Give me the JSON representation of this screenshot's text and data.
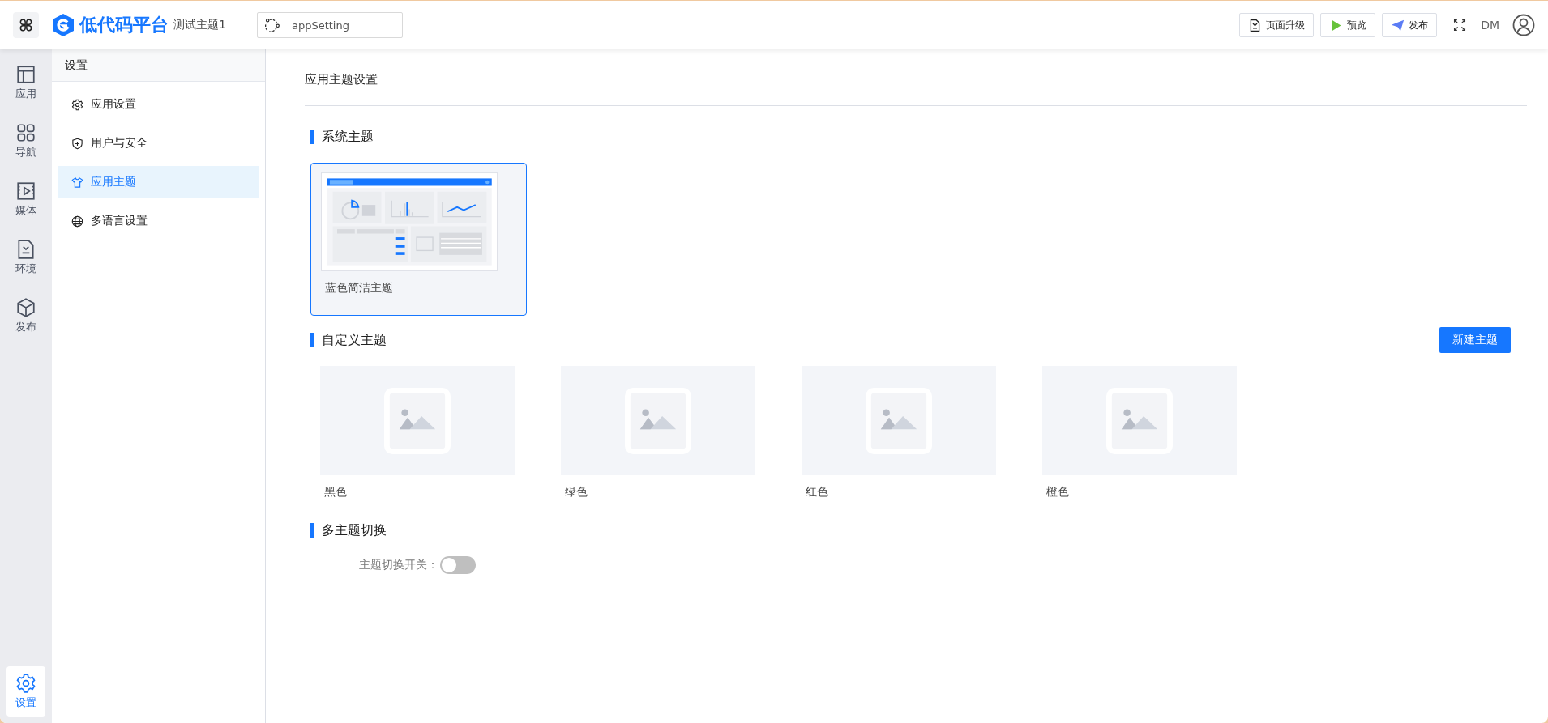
{
  "header": {
    "app_name": "低代码平台",
    "project": "测试主题1",
    "page_selector": "appSetting",
    "buttons": [
      {
        "label": "页面升级",
        "kind": "upgrade"
      },
      {
        "label": "预览",
        "kind": "preview"
      },
      {
        "label": "发布",
        "kind": "publish"
      }
    ],
    "user": "DM"
  },
  "rail": {
    "items": [
      {
        "label": "应用",
        "selected": false
      },
      {
        "label": "导航",
        "selected": false
      },
      {
        "label": "媒体",
        "selected": false
      },
      {
        "label": "环境",
        "selected": false
      },
      {
        "label": "发布",
        "selected": false
      }
    ],
    "bottom": {
      "label": "设置",
      "selected": true
    }
  },
  "sidebar": {
    "title": "设置",
    "items": [
      {
        "label": "应用设置",
        "selected": false
      },
      {
        "label": "用户与安全",
        "selected": false
      },
      {
        "label": "应用主题",
        "selected": true
      },
      {
        "label": "多语言设置",
        "selected": false
      }
    ]
  },
  "content": {
    "title": "应用主题设置",
    "system": {
      "heading": "系统主题",
      "themes": [
        {
          "name": "蓝色简洁主题",
          "selected": true
        }
      ]
    },
    "custom": {
      "heading": "自定义主题",
      "new_button": "新建主题",
      "themes": [
        {
          "name": "黑色"
        },
        {
          "name": "绿色"
        },
        {
          "name": "红色"
        },
        {
          "name": "橙色"
        }
      ]
    },
    "multi": {
      "heading": "多主题切换",
      "switch_label": "主题切换开关：",
      "on": false
    }
  }
}
